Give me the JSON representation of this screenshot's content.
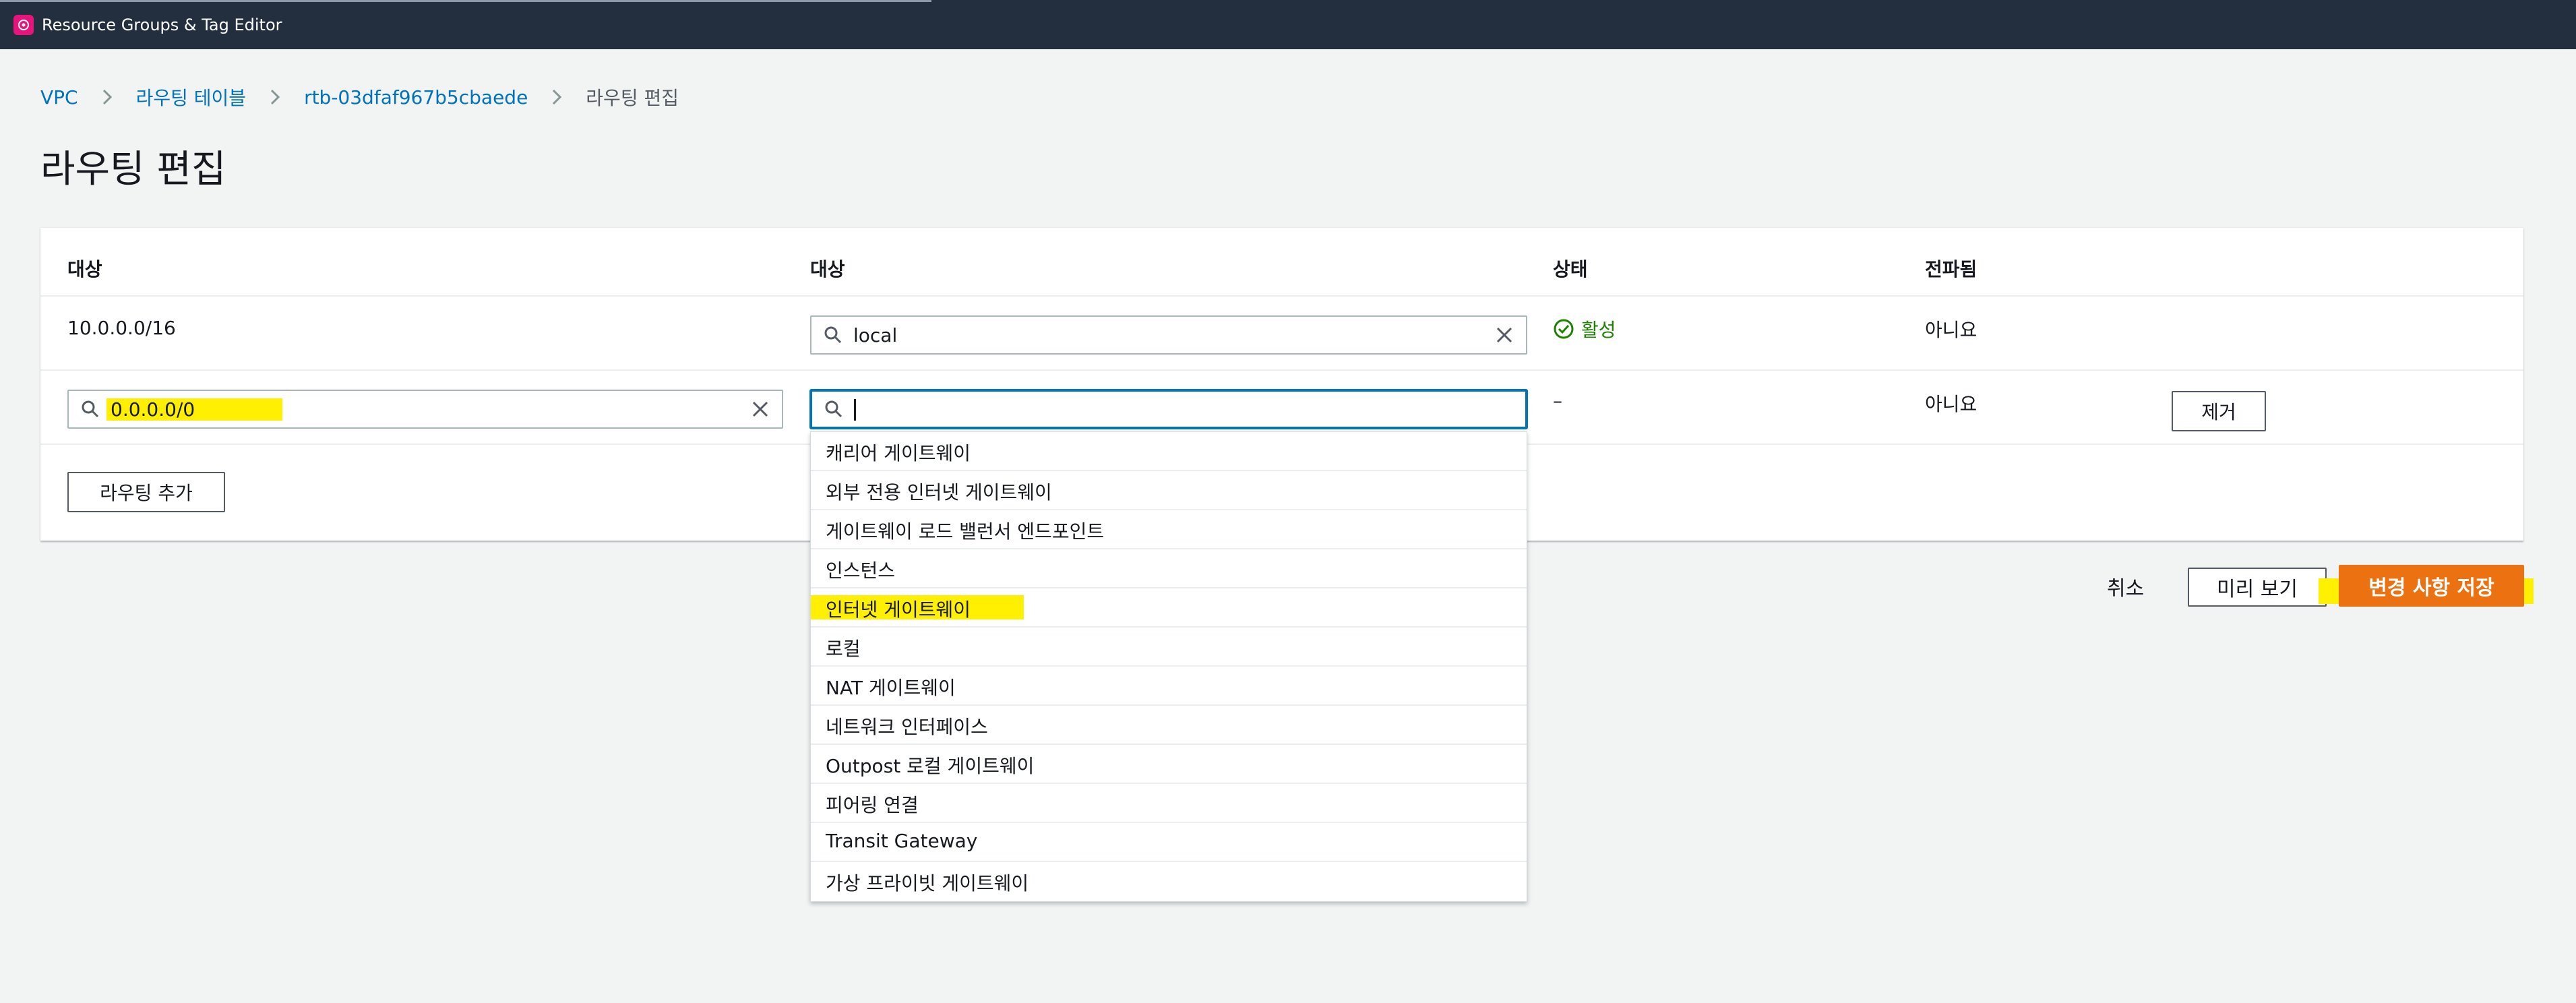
{
  "topbar": {
    "app_title": "Resource Groups & Tag Editor"
  },
  "breadcrumb": {
    "items": [
      "VPC",
      "라우팅 테이블",
      "rtb-03dfaf967b5cbaede"
    ],
    "current": "라우팅 편집"
  },
  "page_title": "라우팅 편집",
  "table": {
    "headers": [
      "대상",
      "대상",
      "상태",
      "전파됨"
    ],
    "rows": [
      {
        "destination": "10.0.0.0/16",
        "target": "local",
        "status": "활성",
        "propagated": "아니요"
      },
      {
        "destination": "0.0.0.0/0",
        "target": "",
        "status": "–",
        "propagated": "아니요",
        "remove_label": "제거"
      }
    ],
    "add_route_label": "라우팅 추가"
  },
  "dropdown": {
    "options": [
      "캐리어 게이트웨이",
      "외부 전용 인터넷 게이트웨이",
      "게이트웨이 로드 밸런서 엔드포인트",
      "인스턴스",
      "인터넷 게이트웨이",
      "로컬",
      "NAT 게이트웨이",
      "네트워크 인터페이스",
      "Outpost 로컬 게이트웨이",
      "피어링 연결",
      "Transit Gateway",
      "가상 프라이빗 게이트웨이"
    ],
    "highlighted": "인터넷 게이트웨이"
  },
  "actions": {
    "cancel": "취소",
    "preview": "미리 보기",
    "save": "변경 사항 저장"
  },
  "colors": {
    "topbar": "#232f3e",
    "link": "#0073bb",
    "primary": "#ec7211",
    "success": "#1d8102",
    "highlight": "#ffef00"
  }
}
